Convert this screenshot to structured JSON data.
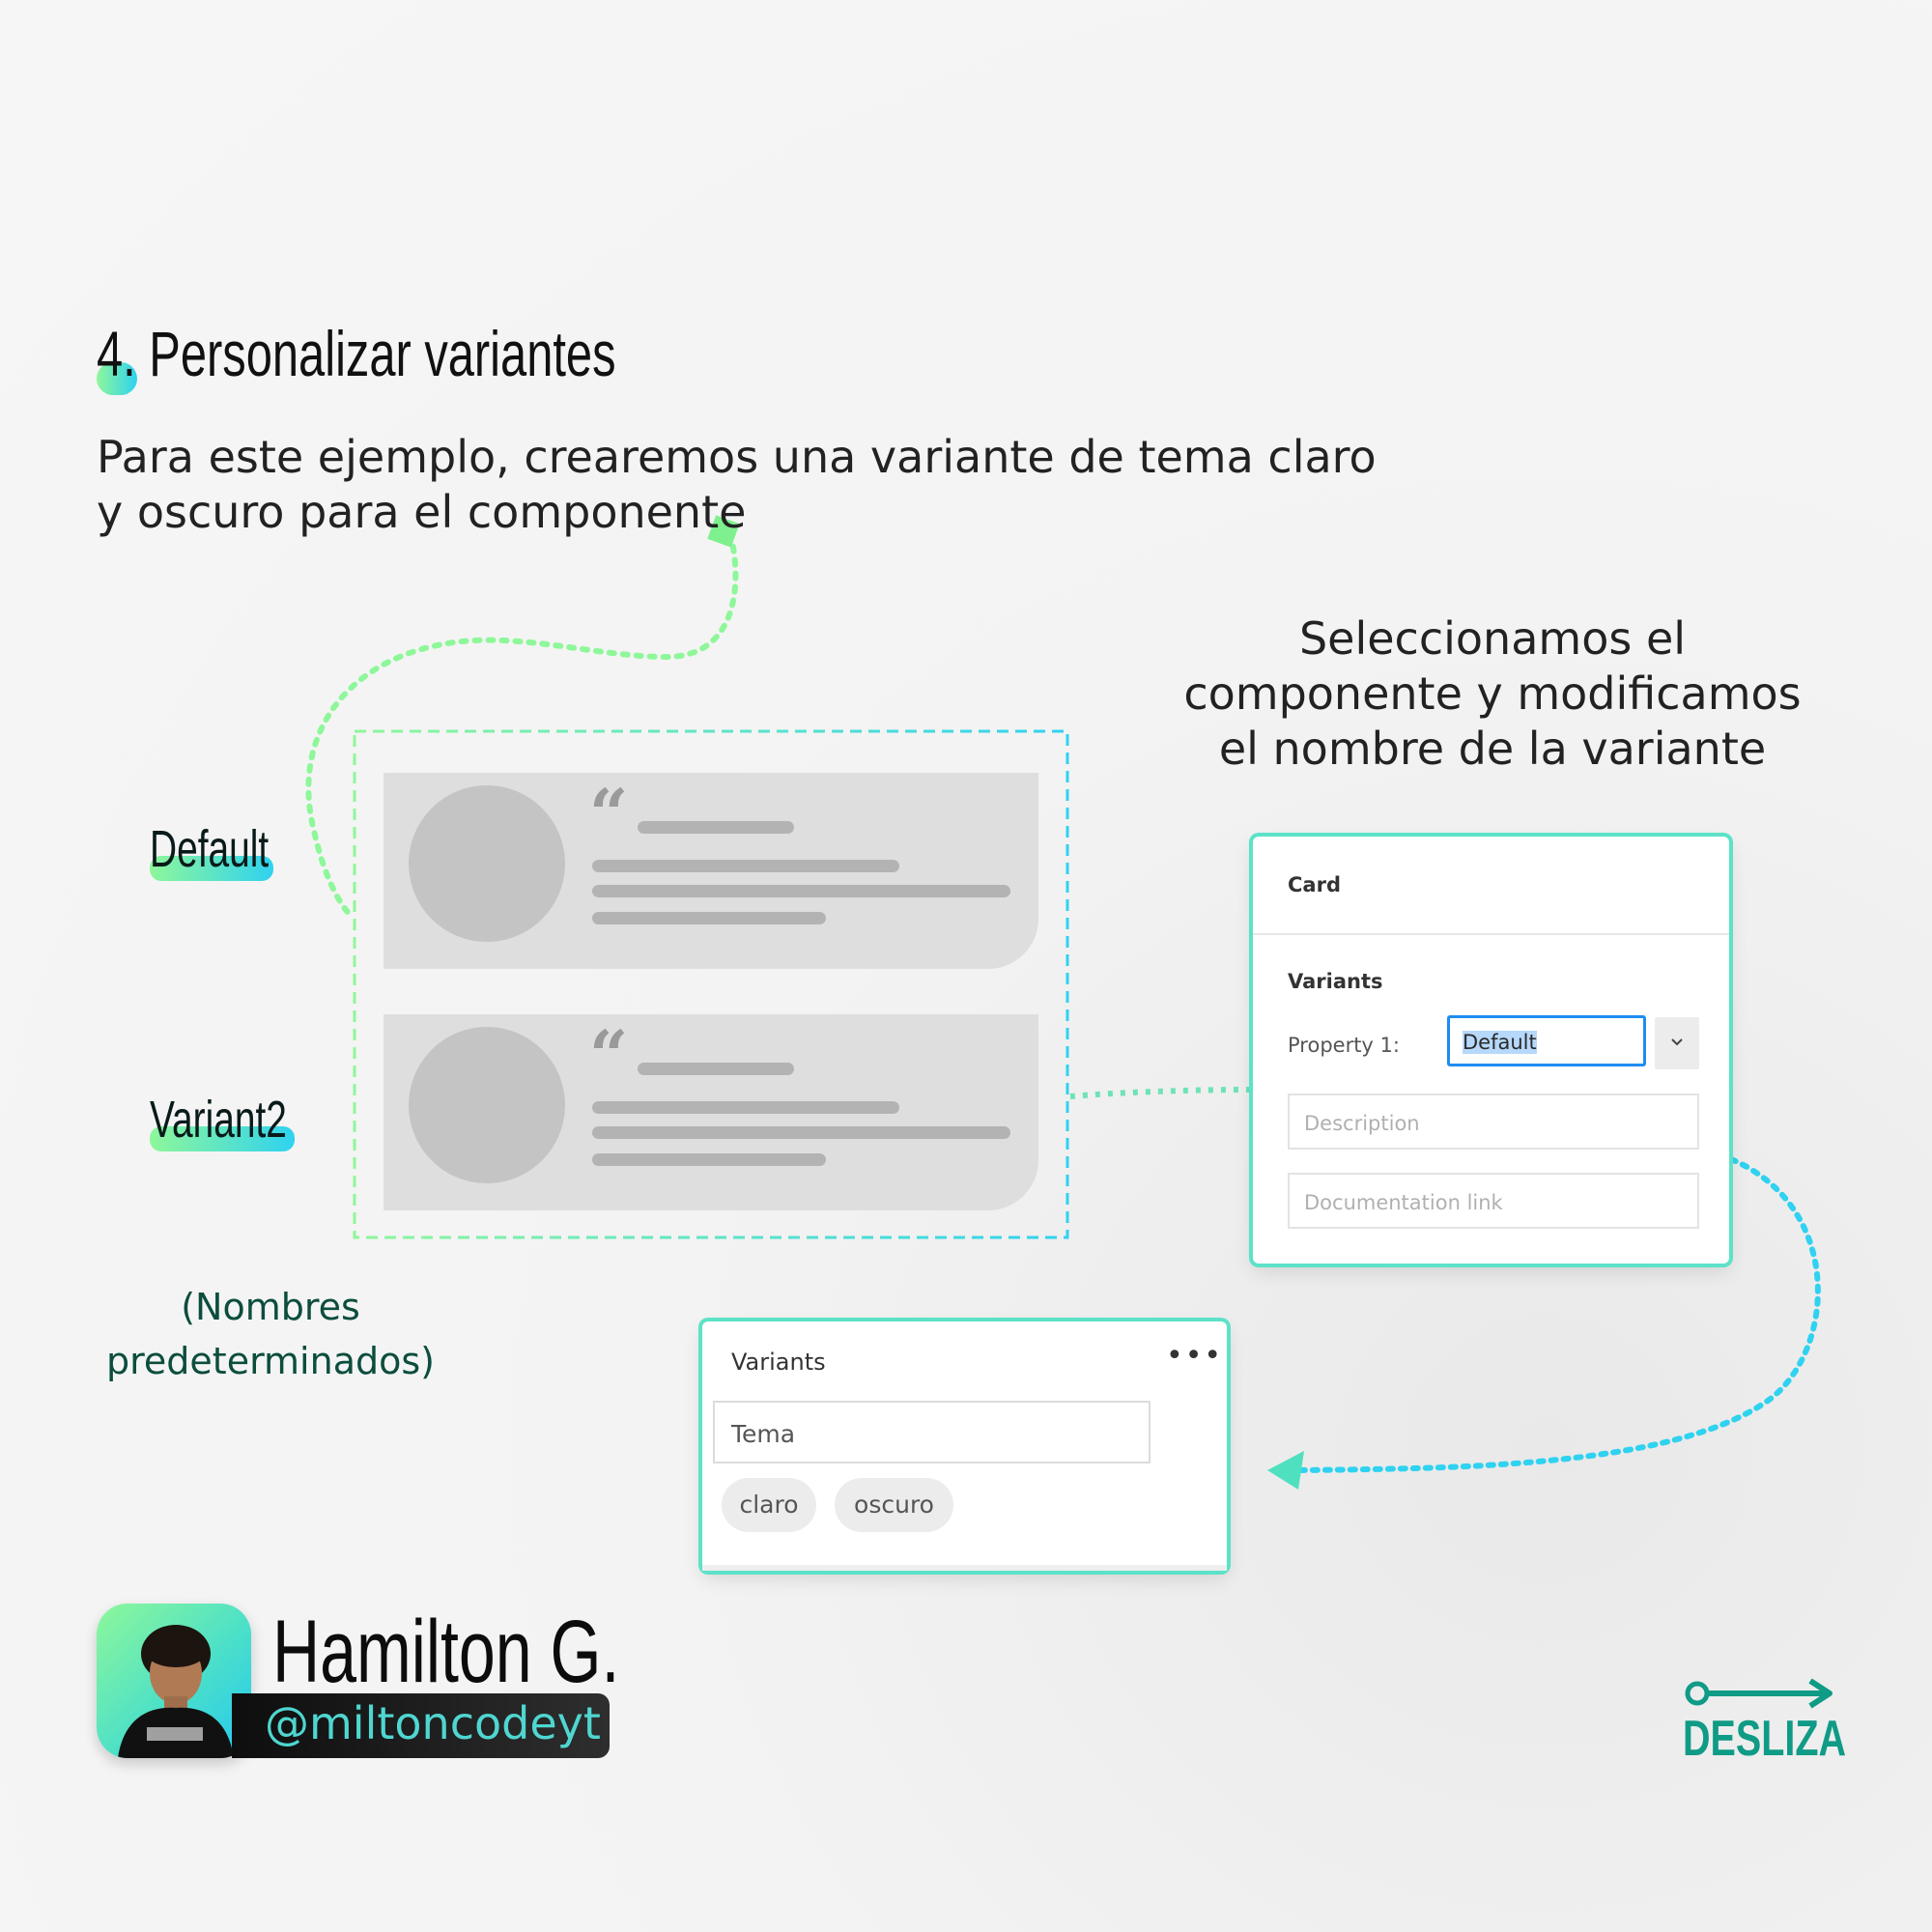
{
  "title": {
    "number": "4.",
    "text": "Personalizar variantes"
  },
  "intro": "Para este ejemplo, crearemos una variante de tema claro y oscuro para el componente",
  "variant_labels": {
    "first": "Default",
    "second": "Variant2"
  },
  "default_names_note": "(Nombres predeterminados)",
  "right_note": "Seleccionamos el componente y modificamos el nombre de la variante",
  "props_panel": {
    "header": "Card",
    "section": "Variants",
    "property_label": "Property 1:",
    "property_value": "Default",
    "description_placeholder": "Description",
    "doc_link_placeholder": "Documentation link"
  },
  "variants_panel": {
    "header": "Variants",
    "menu": "•••",
    "property_name": "Tema",
    "values": [
      "claro",
      "oscuro"
    ]
  },
  "card_quote_glyph": "“",
  "profile": {
    "name": "Hamilton G.",
    "handle": "@miltoncodeyt"
  },
  "swipe": {
    "label": "DESLIZA"
  },
  "colors": {
    "accent_green": "#8ef79a",
    "accent_cyan": "#2fd2f0",
    "teal": "#0f9b86",
    "dark_green_text": "#0c4d3e"
  }
}
